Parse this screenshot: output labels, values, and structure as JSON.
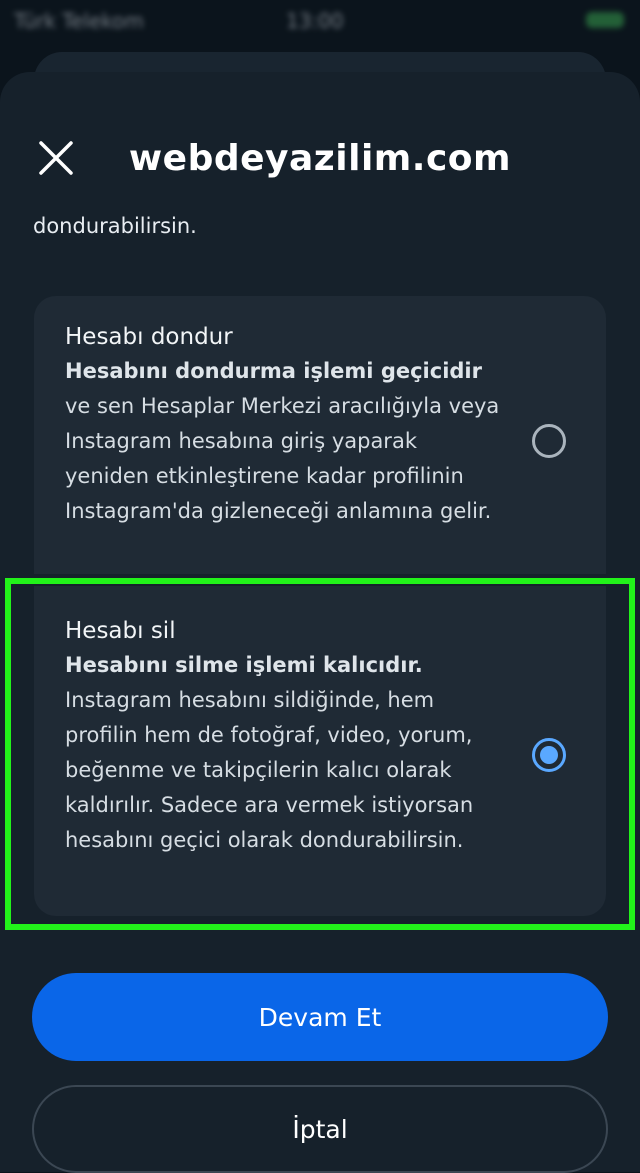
{
  "status_bar": {
    "carrier": "Türk Telekom",
    "time": "13:00",
    "battery": "100%"
  },
  "header": {
    "watermark": "webdeyazilim.com",
    "close_icon": "close-icon"
  },
  "intro_tail": "dondurabilirsin.",
  "options": [
    {
      "title": "Hesabı dondur",
      "lead": "Hesabını dondurma işlemi geçicidir",
      "body": "ve sen Hesaplar Merkezi aracılığıyla veya Instagram hesabına giriş yaparak yeniden etkinleştirene kadar profilinin Instagram'da gizleneceği anlamına gelir.",
      "selected": false
    },
    {
      "title": "Hesabı sil",
      "lead": "Hesabını silme işlemi kalıcıdır.",
      "body": "Instagram hesabını sildiğinde, hem profilin hem de fotoğraf, video, yorum, beğenme ve takipçilerin kalıcı olarak kaldırılır. Sadece ara vermek istiyorsan hesabını geçici olarak dondurabilirsin.",
      "selected": true
    }
  ],
  "buttons": {
    "continue_label": "Devam Et",
    "cancel_label": "İptal"
  },
  "colors": {
    "background": "#0b141c",
    "sheet": "#16212b",
    "card": "#1f2a35",
    "primary": "#0a66e8",
    "radio_selected": "#5aa8ff",
    "highlight": "#22f21a"
  }
}
